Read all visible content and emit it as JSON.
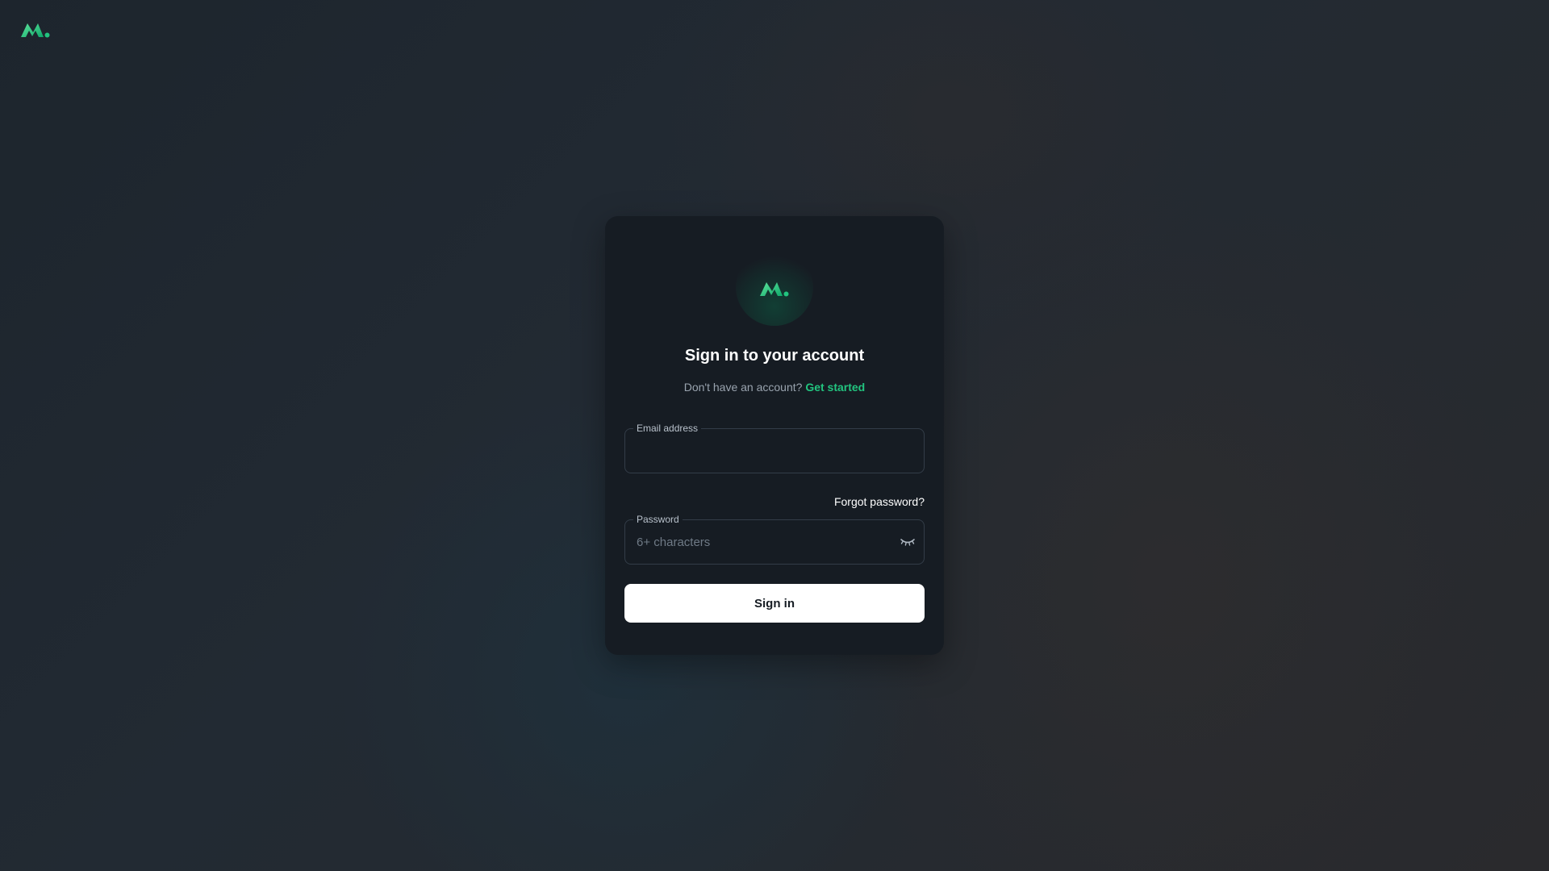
{
  "brand": {
    "logo_icon": "brand-logo-icon",
    "accent_color": "#22c47f"
  },
  "card": {
    "title": "Sign in to your account",
    "subtitle_prefix": "Don't have an account?",
    "get_started_link": "Get started"
  },
  "email": {
    "label": "Email address",
    "value": "",
    "placeholder": ""
  },
  "forgot_password_link": "Forgot password?",
  "password": {
    "label": "Password",
    "value": "",
    "placeholder": "6+ characters",
    "toggle_icon": "eye-closed-icon"
  },
  "signin_button": "Sign in"
}
